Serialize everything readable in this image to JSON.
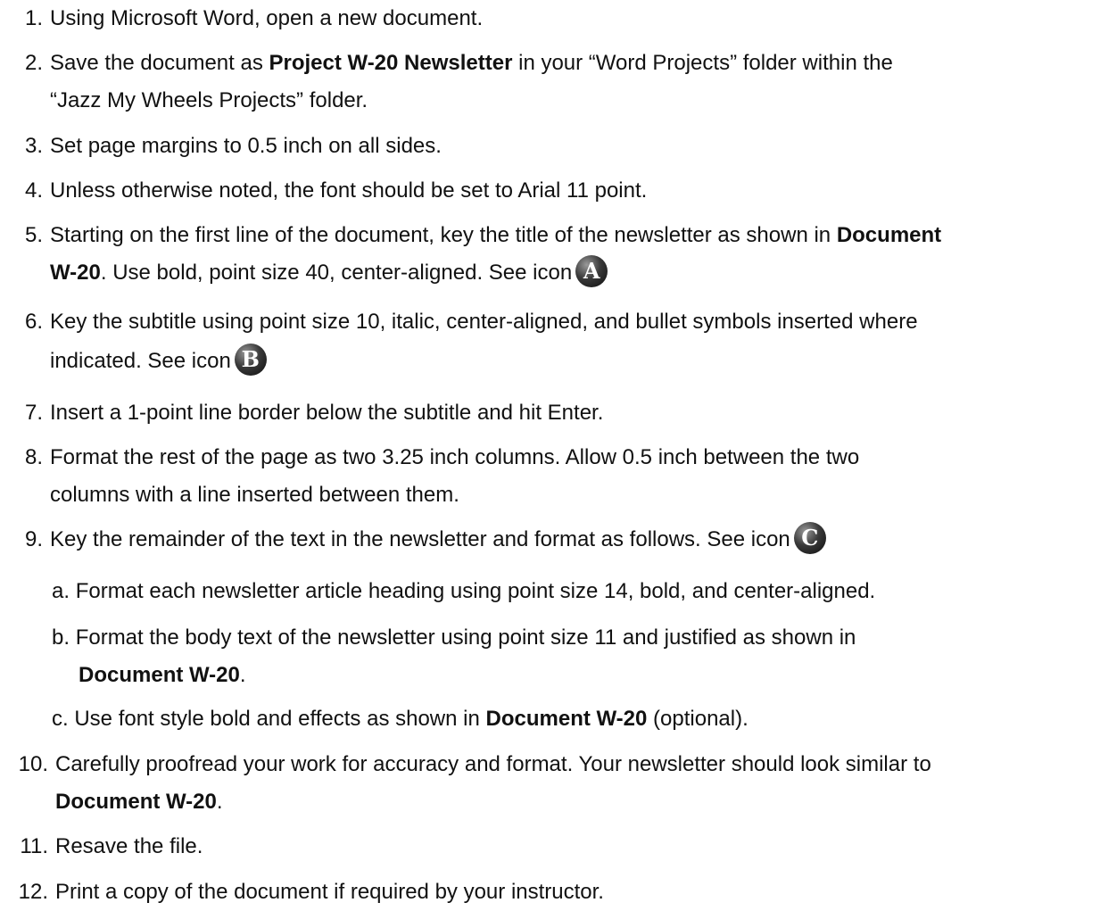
{
  "steps": [
    {
      "num": "1.",
      "text": "Using Microsoft Word, open a new document."
    },
    {
      "num": "2.",
      "pre": "Save the document as ",
      "bold": "Project W-20 Newsletter",
      "post": " in your “Word Projects” folder within the",
      "line2": "“Jazz My Wheels Projects” folder."
    },
    {
      "num": "3.",
      "text": "Set page margins to 0.5 inch on all sides."
    },
    {
      "num": "4.",
      "text": "Unless otherwise noted, the font should be set to Arial 11 point."
    },
    {
      "num": "5.",
      "pre": "Starting on the first line of the document, key the title of the newsletter as shown in ",
      "bold": "Document",
      "line2_bold": "W-20",
      "line2_post": ". Use bold, point size 40, center-aligned. See icon",
      "icon": "A"
    },
    {
      "num": "6.",
      "text": "Key the subtitle using point size 10, italic, center-aligned, and bullet symbols inserted where",
      "line2": "indicated. See icon",
      "icon": "B"
    },
    {
      "num": "7.",
      "text": "Insert a 1-point line border below the subtitle and hit Enter."
    },
    {
      "num": "8.",
      "text": "Format the rest of the page as two 3.25 inch columns. Allow 0.5 inch between the two",
      "line2": "columns with a line inserted between them."
    },
    {
      "num": "9.",
      "text": "Key the remainder of the text in the newsletter and format as follows. See icon",
      "icon": "C"
    },
    {
      "num": "10.",
      "text": "Carefully proofread your work for accuracy and format. Your newsletter should look similar to",
      "line2_bold": "Document W-20",
      "line2_post": "."
    },
    {
      "num": "11.",
      "text": "Resave the file."
    },
    {
      "num": "12.",
      "text": "Print a copy of the document if required by your instructor."
    }
  ],
  "substeps": [
    {
      "label": "a.",
      "text": "Format each newsletter article heading using point size 14, bold, and center-aligned."
    },
    {
      "label": "b.",
      "text": "Format the body text of the newsletter using point size 11 and justified as shown in",
      "line2_bold": "Document W-20",
      "line2_post": "."
    },
    {
      "label": "c.",
      "pre": "Use font style bold and effects as shown in ",
      "bold": "Document W-20",
      "post": " (optional)."
    }
  ],
  "icons": {
    "A": "icon-a",
    "B": "icon-b",
    "C": "icon-c"
  }
}
